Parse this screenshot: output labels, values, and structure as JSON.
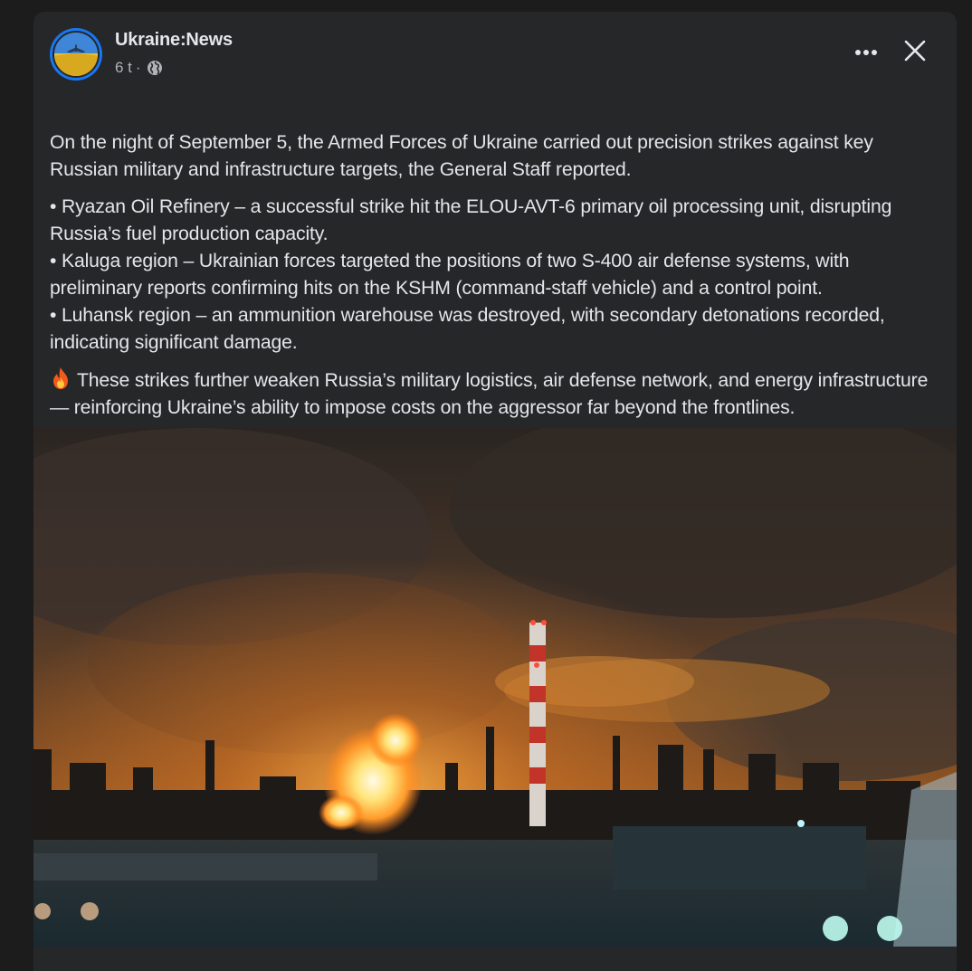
{
  "post": {
    "author": "Ukraine:News",
    "time": "6 t",
    "separator": "·",
    "paragraph1": "On the night of September 5, the Armed Forces of Ukraine carried out precision strikes against key Russian military and infrastructure targets, the General Staff reported.",
    "bullets": [
      "• Ryazan Oil Refinery – a successful strike hit the ELOU-AVT-6 primary oil processing unit, disrupting Russia’s fuel production capacity.",
      "• Kaluga region – Ukrainian forces targeted the positions of two S-400 air defense systems, with preliminary reports confirming hits on the KSHM (command-staff vehicle) and a control point.",
      "• Luhansk region – an ammunition warehouse was destroyed, with secondary detonations recorded, indicating significant damage."
    ],
    "paragraph3": "These strikes further weaken Russia’s military logistics, air defense network, and energy infrastructure — reinforcing Ukraine’s ability to impose costs on the aggressor far beyond the frontlines."
  },
  "icons": {
    "audience": "globe-icon",
    "more": "more-options-icon",
    "close": "close-icon",
    "flag": "ukraine-flag-icon",
    "fire": "fire-icon"
  },
  "colors": {
    "card_bg": "#252728",
    "page_bg": "#1c1c1d",
    "text_primary": "#e4e6eb",
    "text_secondary": "#b0b3b8",
    "avatar_ring": "#1877f2"
  }
}
